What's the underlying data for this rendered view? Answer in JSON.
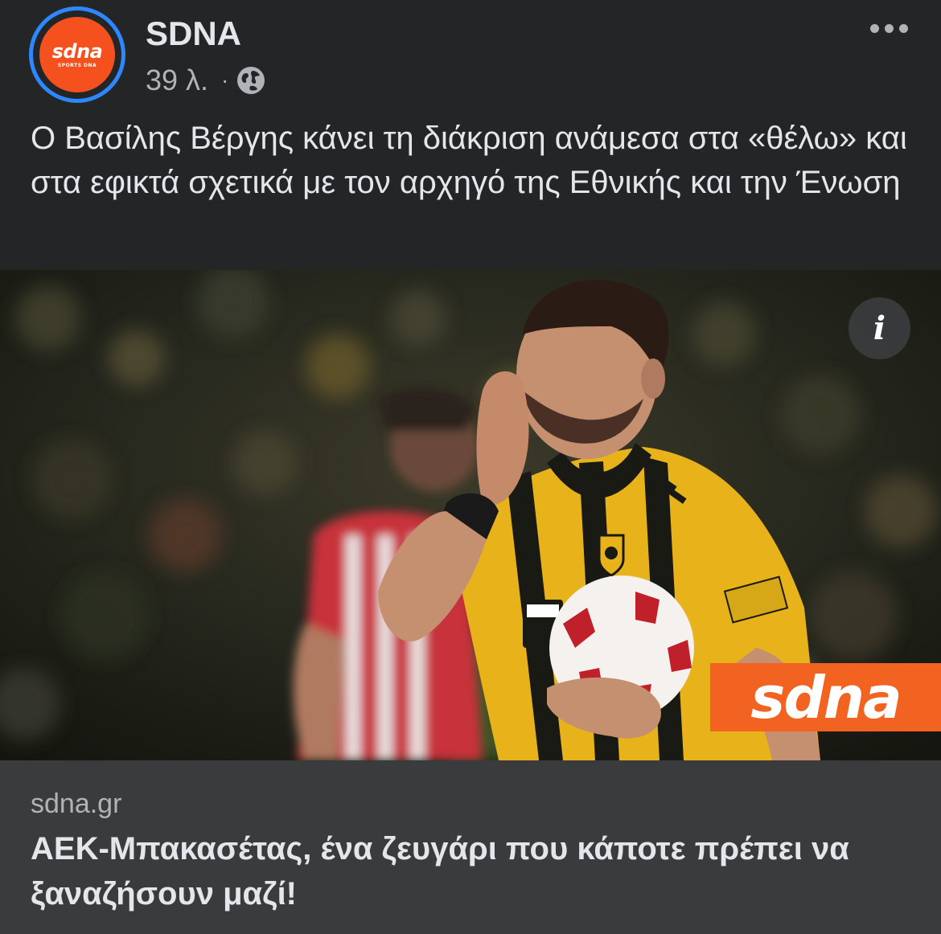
{
  "post": {
    "page_name": "SDNA",
    "avatar": {
      "wordmark": "sdna",
      "subtitle": "SPORTS DNA",
      "ring_color": "#2d88ff",
      "bg_color": "#f4511e"
    },
    "time": "39 λ.",
    "separator": "·",
    "privacy_icon": "globe-icon",
    "more_icon": "more-options-icon",
    "caption": "Ο Βασίλης Βέργης κάνει τη διάκριση ανάμεσα στα «θέλω» και στα εφικτά σχετικά με τον αρχηγό της Εθνικής και την Ένωση"
  },
  "image": {
    "info_label": "i",
    "watermark": "sdna",
    "watermark_color": "#f26322"
  },
  "link_preview": {
    "domain": "sdna.gr",
    "title": "ΑΕΚ-Μπακασέτας, ένα ζευγάρι που κάποτε πρέπει να ξαναζήσουν μαζί!"
  }
}
